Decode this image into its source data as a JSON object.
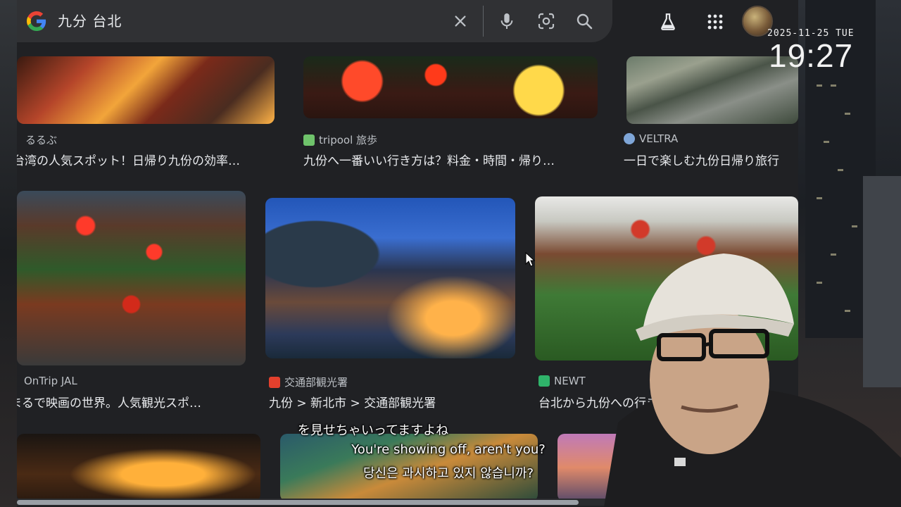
{
  "search": {
    "query": "九分 台北",
    "icons": [
      "clear-icon",
      "microphone-icon",
      "lens-icon",
      "search-icon"
    ]
  },
  "toolbar": {
    "icons": [
      "labs-flask-icon",
      "apps-grid-icon",
      "account-avatar"
    ]
  },
  "clock": {
    "date": "2025-11-25 TUE",
    "time": "19:27"
  },
  "results": {
    "row1": [
      {
        "source": "るるぶ",
        "caption": "台湾の人気スポット！日帰り九份の効率…",
        "favicon_color": "#202124"
      },
      {
        "source": "tripool 旅歩",
        "caption": "九份へ一番いい行き方は？料金・時間・帰り…",
        "favicon_color": "#6fc36b"
      },
      {
        "source": "VELTRA",
        "caption": "一日で楽しむ九份日帰り旅行",
        "favicon_color": "#7fa6d8"
      }
    ],
    "row2": [
      {
        "source": "OnTrip JAL",
        "caption": "まるで映画の世界。人気観光スポ…",
        "favicon_color": "#202124"
      },
      {
        "source": "交通部観光署",
        "caption": "九份 > 新北市 > 交通部観光署",
        "favicon_color": "#e3402d"
      },
      {
        "source": "NEWT",
        "caption": "台北から九份への行き方",
        "favicon_color": "#2fb36a"
      }
    ]
  },
  "subtitles": {
    "japanese": "を見せちゃいってますよね",
    "english": "You're showing off, aren't you?",
    "korean": "당신은 과시하고 있지 않습니까?"
  },
  "colors": {
    "page_bg": "#202124",
    "searchbar_bg": "#303134",
    "text_primary": "#e8eaed",
    "text_secondary": "#bdc1c6"
  }
}
